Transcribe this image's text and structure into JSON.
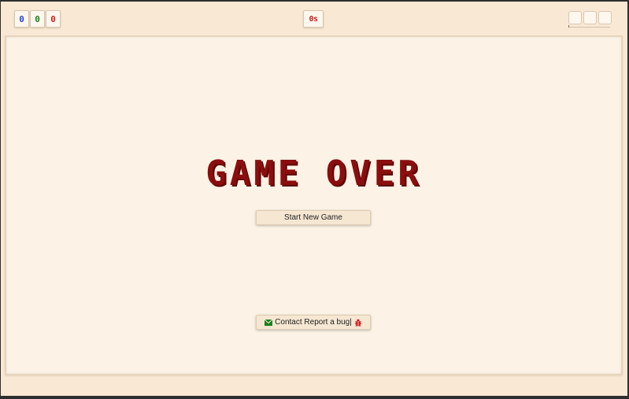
{
  "counters": [
    {
      "value": "0",
      "color": "#2a3fd6",
      "name": "counter-blue"
    },
    {
      "value": "0",
      "color": "#1b7f1b",
      "name": "counter-green"
    },
    {
      "value": "0",
      "color": "#d11a1a",
      "name": "counter-red"
    }
  ],
  "timer": {
    "value": "0s",
    "color": "#d11a1a"
  },
  "game_over_text": "GAME OVER",
  "buttons": {
    "new_game_label": "Start New Game",
    "report_label": "Contact Report a bug|"
  },
  "icons": {
    "report_left": "envelope-icon",
    "report_right": "bug-icon"
  },
  "colors": {
    "background": "#f8e8d4",
    "board": "#fcf3e6",
    "title": "#8b0e0e",
    "envelope": "#1b7f1b",
    "bug": "#d11a1a"
  }
}
